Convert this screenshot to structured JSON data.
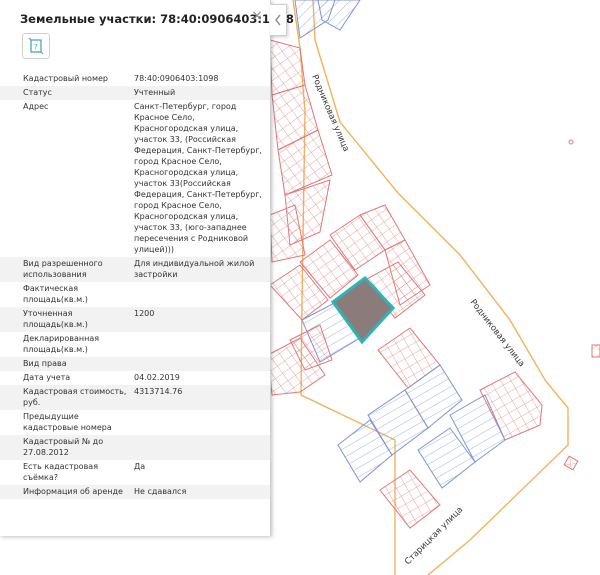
{
  "panel": {
    "title": "Земельные участки: 78:40:0906403:1098",
    "close_glyph": "×",
    "collapse_glyph": "‹",
    "badge_text": "?",
    "rows": [
      {
        "label": "Кадастровый номер",
        "value": "78:40:0906403:1098"
      },
      {
        "label": "Статус",
        "value": "Учтенный"
      },
      {
        "label": "Адрес",
        "value": "Санкт-Петербург, город Красное Село, Красногородская улица, участок 33, (Российская Федерация, Санкт-Петербург, город Красное Село, Красногородская улица, участок 33(Российская Федерация, Санкт-Петербург, город Красное Село, Красногородская улица, участок 33, (юго-западнее пересечения с Родниковой улицей)))"
      },
      {
        "label": "Вид разрешенного использования",
        "value": "Для индивидуальной жилой застройки"
      },
      {
        "label": "Фактическая площадь(кв.м.)",
        "value": ""
      },
      {
        "label": "Уточненная площадь(кв.м.)",
        "value": "1200"
      },
      {
        "label": "Декларированная площадь(кв.м.)",
        "value": ""
      },
      {
        "label": "Вид права",
        "value": ""
      },
      {
        "label": "Дата учета",
        "value": "04.02.2019"
      },
      {
        "label": "Кадастровая стоимость, руб.",
        "value": "4313714.76"
      },
      {
        "label": "Предыдущие кадастровые номера",
        "value": ""
      },
      {
        "label": "Кадастровый № до 27.08.2012",
        "value": ""
      },
      {
        "label": "Есть кадастровая съёмка?",
        "value": "Да"
      },
      {
        "label": "Информация об аренде",
        "value": "Не сдавался"
      }
    ]
  },
  "map": {
    "street_labels": [
      "Родниковая улица",
      "Родниковая улица",
      "Старицкая улица"
    ]
  },
  "colors": {
    "road": "#f2b25c",
    "parcel_red": "#e07878",
    "parcel_blue": "#7f93d6",
    "selected_fill": "#8c7b7b",
    "selected_border": "#2bb5b5"
  }
}
